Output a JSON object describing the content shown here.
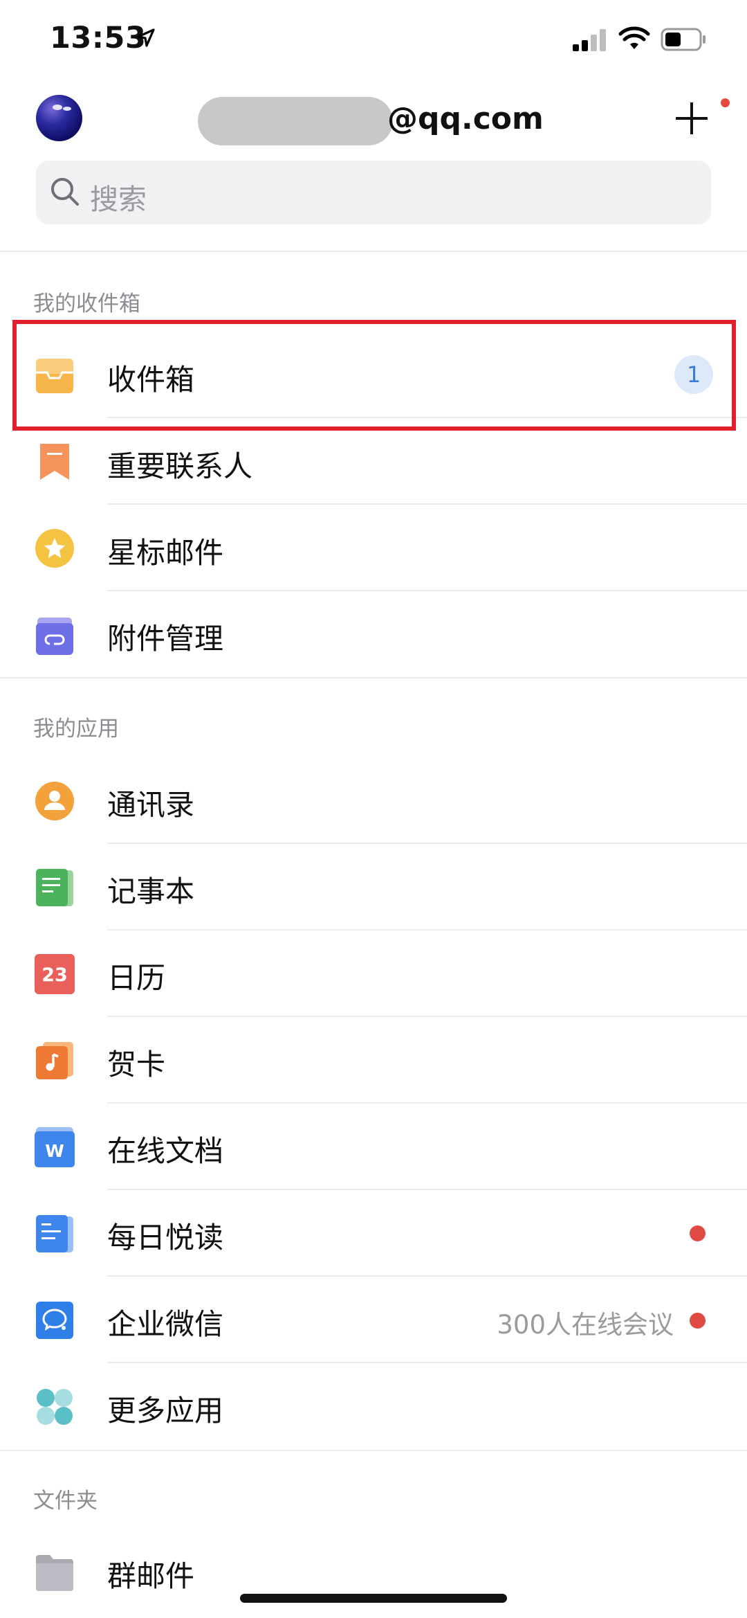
{
  "status": {
    "time": "13:53"
  },
  "header": {
    "account_suffix": "@qq.com"
  },
  "search": {
    "placeholder": "搜索"
  },
  "sections": {
    "mailbox": {
      "title": "我的收件箱",
      "items": [
        {
          "label": "收件箱",
          "badge": "1",
          "icon": "inbox-icon"
        },
        {
          "label": "重要联系人",
          "icon": "bookmark-icon"
        },
        {
          "label": "星标邮件",
          "icon": "star-icon"
        },
        {
          "label": "附件管理",
          "icon": "attachment-icon"
        }
      ]
    },
    "apps": {
      "title": "我的应用",
      "items": [
        {
          "label": "通讯录",
          "icon": "contacts-icon"
        },
        {
          "label": "记事本",
          "icon": "notepad-icon"
        },
        {
          "label": "日历",
          "icon": "calendar-icon",
          "icon_text": "23"
        },
        {
          "label": "贺卡",
          "icon": "greeting-card-icon"
        },
        {
          "label": "在线文档",
          "icon": "document-icon",
          "icon_text": "W"
        },
        {
          "label": "每日悦读",
          "icon": "reading-icon",
          "has_dot": true
        },
        {
          "label": "企业微信",
          "icon": "wecom-icon",
          "subtitle": "300人在线会议",
          "has_dot": true
        },
        {
          "label": "更多应用",
          "icon": "more-apps-icon"
        }
      ]
    },
    "folders": {
      "title": "文件夹",
      "items": [
        {
          "label": "群邮件",
          "icon": "folder-icon"
        }
      ]
    }
  },
  "colors": {
    "highlight": "#e0212b",
    "badge_bg": "#dde9f8",
    "badge_text": "#3d7bd6",
    "dot": "#e14a42"
  }
}
